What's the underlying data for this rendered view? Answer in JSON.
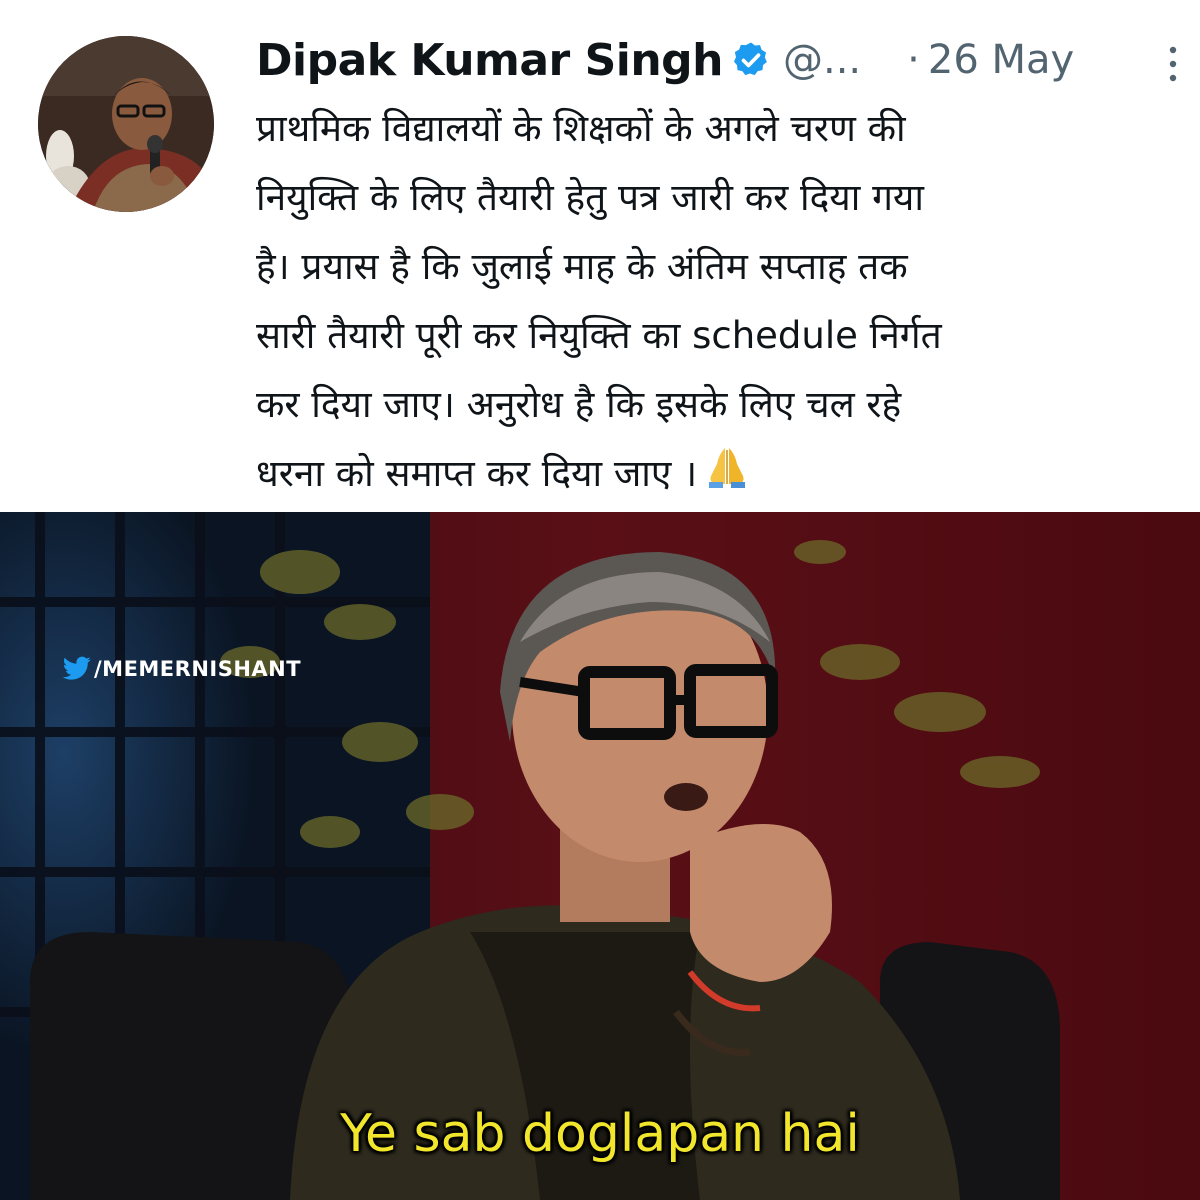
{
  "tweet": {
    "author_name": "Dipak Kumar Singh",
    "handle": "@...",
    "separator": "·",
    "date": "26 May",
    "text_lines": [
      "प्राथमिक विद्यालयों के शिक्षकों के अगले चरण की",
      "नियुक्ति के लिए तैयारी हेतु पत्र जारी कर दिया गया",
      "है।  प्रयास है कि जुलाई माह के अंतिम सप्ताह तक",
      "सारी तैयारी पूरी कर नियुक्ति का schedule निर्गत",
      "कर दिया जाए। अनुरोध है कि इसके लिए चल रहे",
      "धरना को समाप्त कर दिया जाए ।"
    ],
    "verified_badge_color": "#1d9bf0",
    "icons": {
      "verified": "verified-badge-icon",
      "more": "more-options-icon",
      "emoji": "folded-hands-emoji"
    }
  },
  "meme": {
    "watermark_text": "/MEMERNISHANT",
    "watermark_icon": "twitter-bird-icon",
    "caption": "Ye sab doglapan hai",
    "caption_color": "#f1e62c"
  }
}
